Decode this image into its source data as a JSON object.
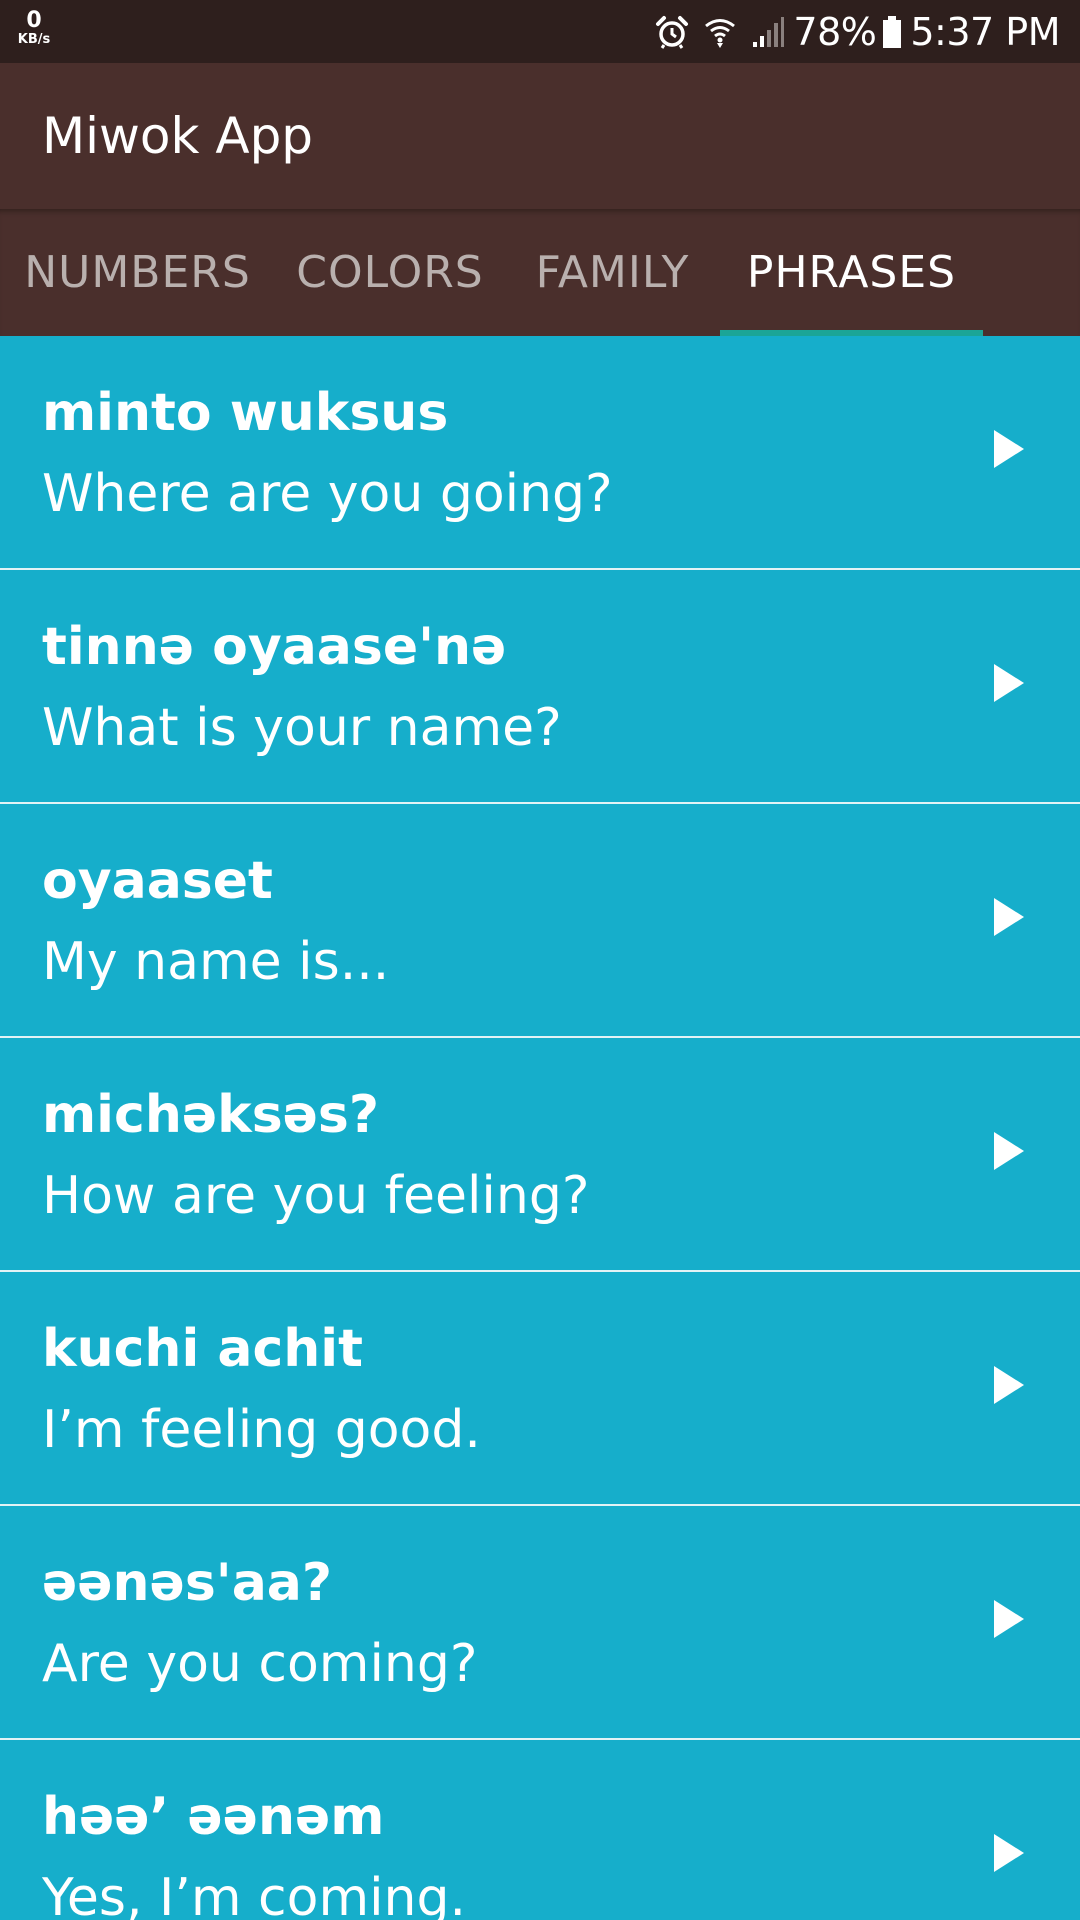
{
  "status_bar": {
    "net_speed_value": "0",
    "net_speed_unit": "KB/s",
    "icons": [
      "alarm-icon",
      "wifi-icon",
      "signal-icon",
      "battery-icon"
    ],
    "battery": "78%",
    "time": "5:37 PM"
  },
  "app_bar": {
    "title": "Miwok App"
  },
  "tabs": [
    {
      "label": "NUMBERS",
      "active": false
    },
    {
      "label": "COLORS",
      "active": false
    },
    {
      "label": "FAMILY",
      "active": false
    },
    {
      "label": "PHRASES",
      "active": true
    }
  ],
  "phrases": [
    {
      "miwok": "minto wuksus",
      "english": "Where are you going?"
    },
    {
      "miwok": "tinnə oyaase'nə",
      "english": "What is your name?"
    },
    {
      "miwok": "oyaaset",
      "english": "My name is..."
    },
    {
      "miwok": "michəksəs?",
      "english": "How are you feeling?"
    },
    {
      "miwok": "kuchi achit",
      "english": "I’m feeling good."
    },
    {
      "miwok": "əənəs'aa?",
      "english": "Are you coming?"
    },
    {
      "miwok": "həə’ əənəm",
      "english": "Yes, I’m coming."
    }
  ],
  "colors": {
    "status_bar_bg": "#2e1f1d",
    "app_bar_bg": "#4a2f2c",
    "tab_indicator": "#1ba597",
    "list_bg": "#16aecb",
    "divider": "#e2f3f6",
    "text": "#ffffff",
    "tab_inactive_text": "#b9b0ae"
  }
}
